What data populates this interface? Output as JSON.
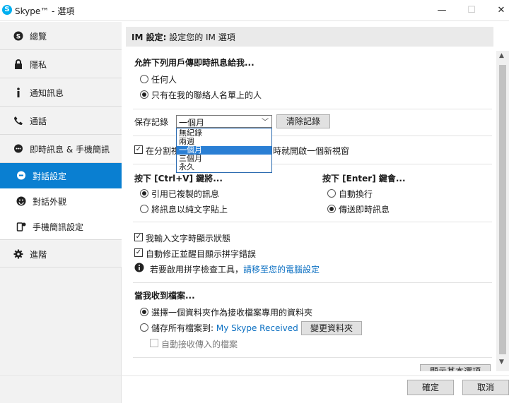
{
  "window": {
    "title": "Skype™ - 選項",
    "app_icon": "skype-logo",
    "controls": {
      "minimize": "—",
      "maximize": "☐",
      "close": "✕"
    }
  },
  "sidebar": {
    "items": [
      {
        "label": "總覽",
        "icon": "skype-icon",
        "type": "top"
      },
      {
        "label": "隱私",
        "icon": "lock-icon",
        "type": "top"
      },
      {
        "label": "通知訊息",
        "icon": "info-icon",
        "type": "top"
      },
      {
        "label": "通話",
        "icon": "phone-icon",
        "type": "top"
      },
      {
        "label": "即時訊息 & 手機簡訊",
        "icon": "chat-bubble-icon",
        "type": "top"
      },
      {
        "label": "對話設定",
        "icon": "chat-settings-icon",
        "type": "sub",
        "active": true
      },
      {
        "label": "對話外觀",
        "icon": "smiley-icon",
        "type": "sub"
      },
      {
        "label": "手機簡訊設定",
        "icon": "sms-icon",
        "type": "sub"
      },
      {
        "label": "進階",
        "icon": "gear-icon",
        "type": "top"
      }
    ]
  },
  "header": {
    "bold": "IM 設定:",
    "text": " 設定您的 IM 選項"
  },
  "allow_section": {
    "title": "允許下列用戶傳即時訊息給我...",
    "options": [
      "任何人",
      "只有在我的聯絡人名單上的人"
    ],
    "selected": 1
  },
  "history": {
    "label": "保存記錄",
    "value": "一個月",
    "clear_button": "清除記錄",
    "options": [
      "無紀錄",
      "兩週",
      "一個月",
      "三個月",
      "永久"
    ],
    "highlighted": 2
  },
  "split_window": {
    "text_left": "在分割視",
    "text_right": "時就開啟一個新視窗",
    "checked": true
  },
  "ctrl_v": {
    "title": "按下 [Ctrl+V] 鍵將...",
    "options": [
      "引用已複製的訊息",
      "將訊息以純文字貼上"
    ],
    "selected": 0
  },
  "enter_key": {
    "title": "按下 [Enter] 鍵會...",
    "options": [
      "自動換行",
      "傳送即時訊息"
    ],
    "selected": 1
  },
  "typing": {
    "show_typing": "我輸入文字時顯示狀態",
    "autocorrect": "自動修正並醒目顯示拼字錯誤"
  },
  "spell_info": {
    "text": "若要啟用拼字檢查工具，",
    "link": "請移至您的電腦設定"
  },
  "files": {
    "title": "當我收到檔案...",
    "option1": "選擇一個資料夾作為接收檔案專用的資料夾",
    "option2_prefix": "儲存所有檔案到: ",
    "option2_link": "My Skype Received Files",
    "change_folder": "變更資料夾",
    "auto_accept": "自動接收傳入的檔案",
    "selected": 0
  },
  "advanced_button_partial": "顯示其本選項",
  "footer": {
    "ok": "確定",
    "cancel": "取消"
  }
}
